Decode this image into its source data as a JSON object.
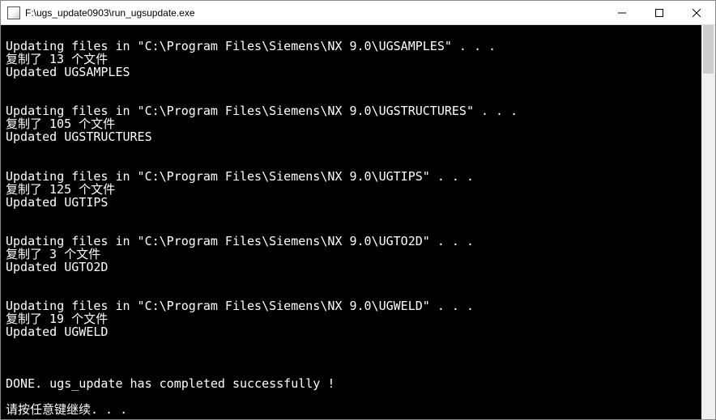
{
  "window": {
    "title": "F:\\ugs_update0903\\run_ugsupdate.exe"
  },
  "console": {
    "lines": [
      "",
      "Updating files in \"C:\\Program Files\\Siemens\\NX 9.0\\UGSAMPLES\" . . .",
      "复制了 13 个文件",
      "Updated UGSAMPLES",
      "",
      "",
      "Updating files in \"C:\\Program Files\\Siemens\\NX 9.0\\UGSTRUCTURES\" . . .",
      "复制了 105 个文件",
      "Updated UGSTRUCTURES",
      "",
      "",
      "Updating files in \"C:\\Program Files\\Siemens\\NX 9.0\\UGTIPS\" . . .",
      "复制了 125 个文件",
      "Updated UGTIPS",
      "",
      "",
      "Updating files in \"C:\\Program Files\\Siemens\\NX 9.0\\UGTO2D\" . . .",
      "复制了 3 个文件",
      "Updated UGTO2D",
      "",
      "",
      "Updating files in \"C:\\Program Files\\Siemens\\NX 9.0\\UGWELD\" . . .",
      "复制了 19 个文件",
      "Updated UGWELD",
      "",
      "",
      "",
      "DONE. ugs_update has completed successfully !",
      "",
      "请按任意键继续. . ."
    ]
  }
}
